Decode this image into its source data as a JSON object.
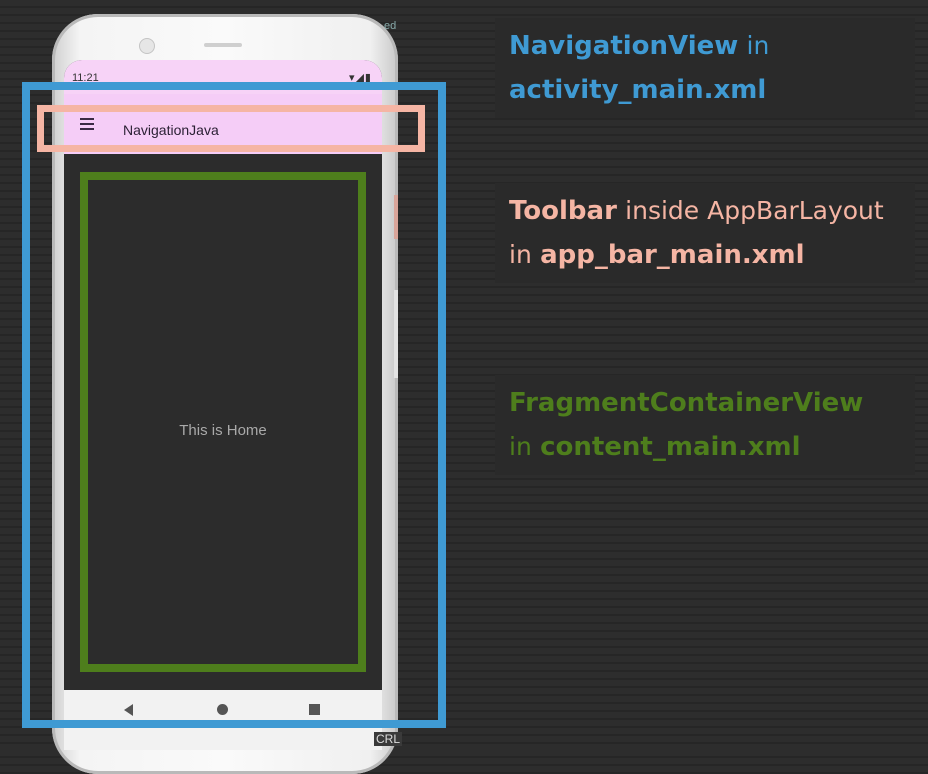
{
  "phone": {
    "status_time": "11:21",
    "status_icons": "▾◢▮",
    "app_title": "NavigationJava",
    "content_text": "This is Home",
    "corner_top": "ed",
    "corner_bottom": "CRL"
  },
  "callouts": {
    "navigation_view": {
      "name": "NavigationView",
      "in": "in",
      "file": "activity_main.xml"
    },
    "toolbar": {
      "name": "Toolbar",
      "inside": "inside AppBarLayout",
      "in": "in",
      "file": "app_bar_main.xml"
    },
    "fragment": {
      "name": "FragmentContainerView",
      "in": "in",
      "file": "content_main.xml"
    }
  },
  "colors": {
    "navigation_view": "#3f9ad3",
    "toolbar": "#f5b5a4",
    "fragment": "#4e7e1c",
    "app_bar": "#f5cdf7"
  },
  "icons": [
    "menu-icon",
    "back-icon",
    "home-icon",
    "recent-apps-icon",
    "camera-icon"
  ]
}
